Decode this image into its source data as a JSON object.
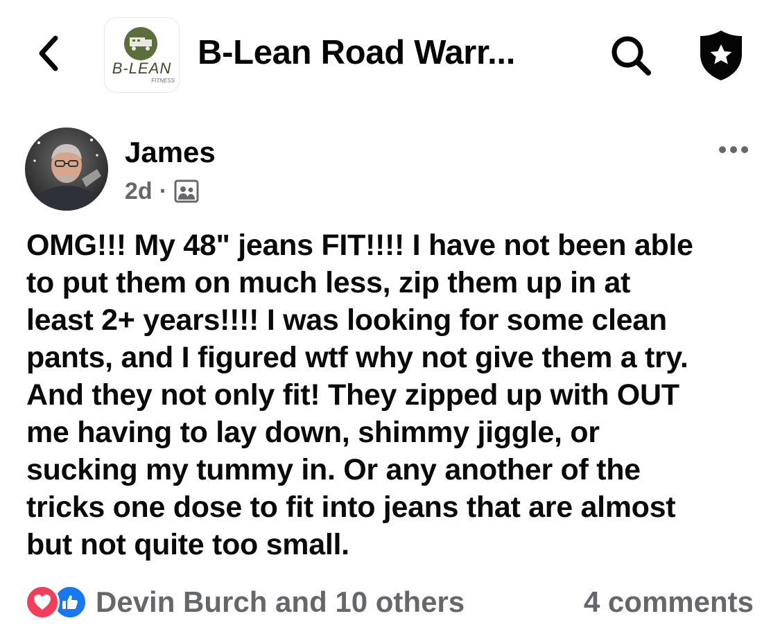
{
  "header": {
    "group_title": "B-Lean Road Warr...",
    "logo_text": "B-LEAN",
    "logo_subtext": "FITNESS",
    "icons": [
      "back-arrow-icon",
      "search-icon",
      "admin-shield-star-icon"
    ]
  },
  "post": {
    "author": "James",
    "time": "2d",
    "separator": "·",
    "audience_icon": "group-audience-icon",
    "text_lines": [
      "OMG!!! My 48\" jeans FIT!!!! I have not been able",
      "to put them on much less, zip them up in at",
      "least 2+ years!!!! I was looking for some clean",
      "pants, and I figured wtf why not give them a try.",
      "And they not only fit! They zipped up with OUT",
      "me having to lay down, shimmy jiggle, or",
      "sucking my tummy in. Or any another of the",
      "tricks one dose to fit into jeans that are almost",
      "but not quite too small."
    ]
  },
  "footer": {
    "reactions_text": "Devin Burch and 10 others",
    "reaction_icons": [
      "love-reaction-icon",
      "like-reaction-icon"
    ],
    "comments_text": "4 comments"
  },
  "colors": {
    "secondary_text": "#65676b",
    "like_blue": "#1877f2",
    "love_red": "#f23e5c",
    "logo_green": "#3b4a2a"
  }
}
